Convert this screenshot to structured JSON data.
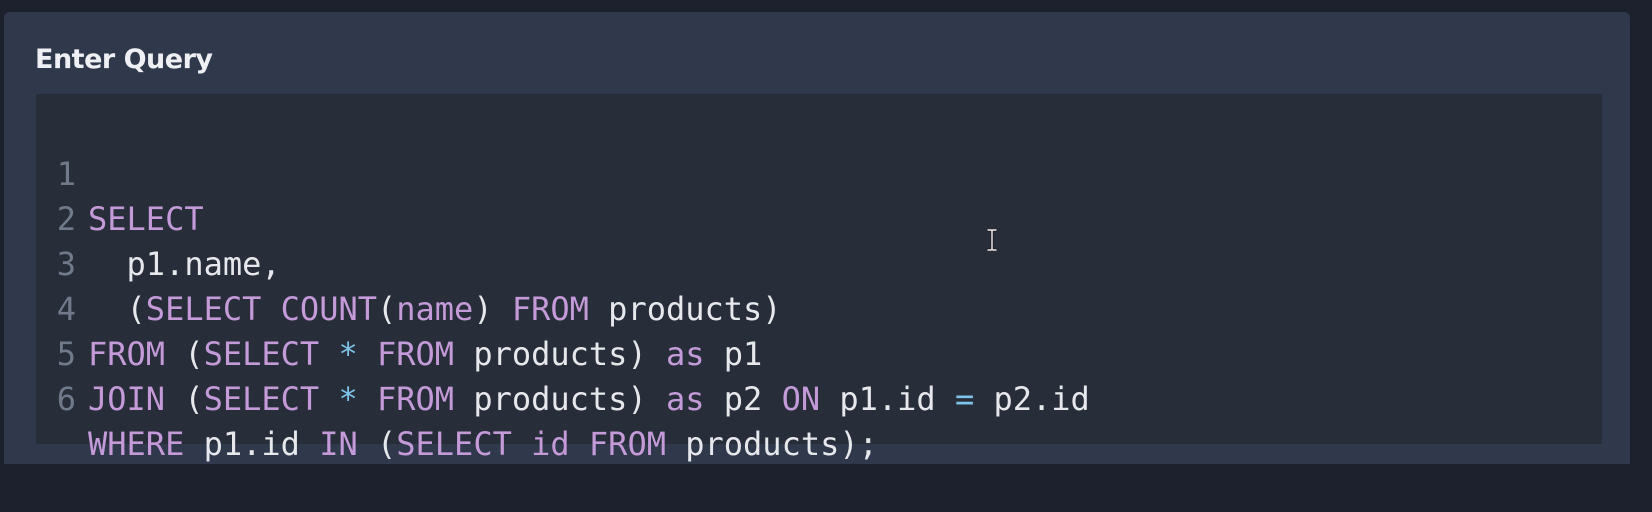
{
  "panel": {
    "title": "Enter Query"
  },
  "editor": {
    "lines": [
      {
        "number": "1",
        "tokens": [
          {
            "text": "SELECT",
            "type": "kw"
          }
        ]
      },
      {
        "number": "2",
        "tokens": [
          {
            "text": "  p1.name,",
            "type": "id"
          }
        ]
      },
      {
        "number": "3",
        "tokens": [
          {
            "text": "  (",
            "type": "id"
          },
          {
            "text": "SELECT",
            "type": "kw"
          },
          {
            "text": " ",
            "type": "id"
          },
          {
            "text": "COUNT",
            "type": "kw"
          },
          {
            "text": "(",
            "type": "id"
          },
          {
            "text": "name",
            "type": "kw"
          },
          {
            "text": ") ",
            "type": "id"
          },
          {
            "text": "FROM",
            "type": "kw"
          },
          {
            "text": " products)",
            "type": "id"
          }
        ]
      },
      {
        "number": "4",
        "tokens": [
          {
            "text": "FROM",
            "type": "kw"
          },
          {
            "text": " (",
            "type": "id"
          },
          {
            "text": "SELECT",
            "type": "kw"
          },
          {
            "text": " ",
            "type": "id"
          },
          {
            "text": "*",
            "type": "op"
          },
          {
            "text": " ",
            "type": "id"
          },
          {
            "text": "FROM",
            "type": "kw"
          },
          {
            "text": " products) ",
            "type": "id"
          },
          {
            "text": "as",
            "type": "kw"
          },
          {
            "text": " p1",
            "type": "id"
          }
        ]
      },
      {
        "number": "5",
        "tokens": [
          {
            "text": "JOIN",
            "type": "kw"
          },
          {
            "text": " (",
            "type": "id"
          },
          {
            "text": "SELECT",
            "type": "kw"
          },
          {
            "text": " ",
            "type": "id"
          },
          {
            "text": "*",
            "type": "op"
          },
          {
            "text": " ",
            "type": "id"
          },
          {
            "text": "FROM",
            "type": "kw"
          },
          {
            "text": " products) ",
            "type": "id"
          },
          {
            "text": "as",
            "type": "kw"
          },
          {
            "text": " p2 ",
            "type": "id"
          },
          {
            "text": "ON",
            "type": "kw"
          },
          {
            "text": " p1.id ",
            "type": "id"
          },
          {
            "text": "=",
            "type": "op"
          },
          {
            "text": " p2.id",
            "type": "id"
          }
        ]
      },
      {
        "number": "6",
        "tokens": [
          {
            "text": "WHERE",
            "type": "kw"
          },
          {
            "text": " p1.id ",
            "type": "id"
          },
          {
            "text": "IN",
            "type": "kw"
          },
          {
            "text": " (",
            "type": "id"
          },
          {
            "text": "SELECT",
            "type": "kw"
          },
          {
            "text": " ",
            "type": "id"
          },
          {
            "text": "id",
            "type": "kw"
          },
          {
            "text": " ",
            "type": "id"
          },
          {
            "text": "FROM",
            "type": "kw"
          },
          {
            "text": " products);",
            "type": "id"
          }
        ]
      }
    ]
  },
  "colors": {
    "page_background": "#1c212d",
    "panel_background": "#30384c",
    "editor_background": "#272e3a",
    "keyword": "#c49ad9",
    "operator": "#7ec3e8",
    "text": "#e6e8ec",
    "line_number": "#717a8a"
  },
  "icons": {
    "cursor": "text-cursor-icon"
  }
}
